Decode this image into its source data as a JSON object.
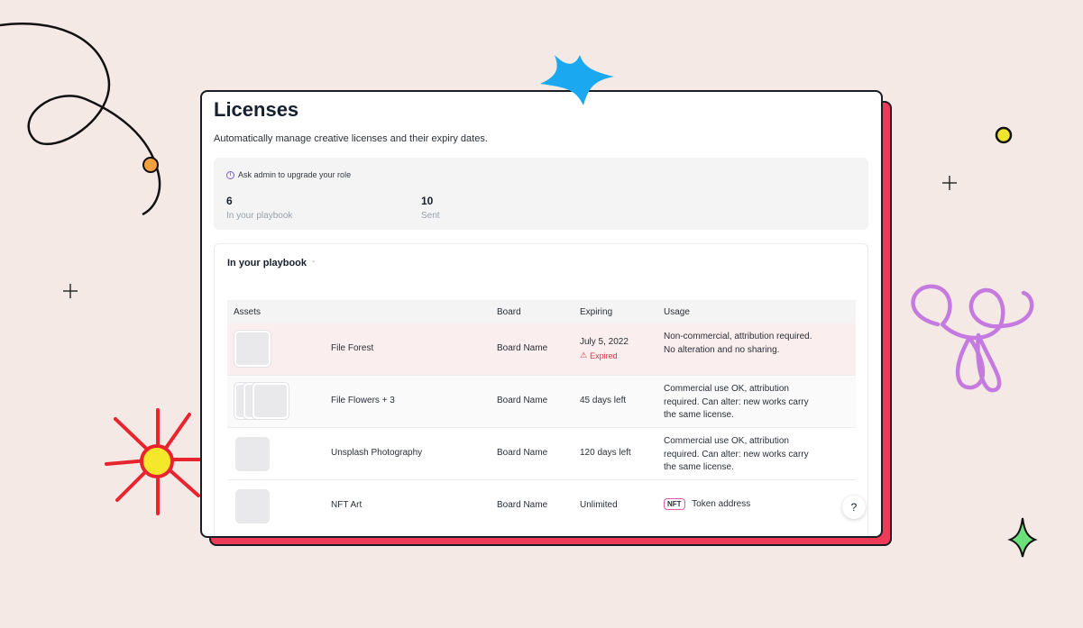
{
  "page": {
    "title": "Licenses",
    "subtitle": "Automatically manage creative licenses and their expiry dates."
  },
  "stats": {
    "note": "Ask admin to upgrade your role",
    "items": [
      {
        "value": "6",
        "label": "In your playbook"
      },
      {
        "value": "10",
        "label": "Sent"
      }
    ]
  },
  "section": {
    "title": "In your playbook",
    "caret": "-"
  },
  "table": {
    "headers": {
      "assets": "Assets",
      "board": "Board",
      "expiring": "Expiring",
      "usage": "Usage"
    },
    "rows": [
      {
        "name": "File Forest",
        "board": "Board Name",
        "expiring": "July 5, 2022",
        "status": "Expired",
        "usage": "Non-commercial, attribution required. No alteration and no sharing."
      },
      {
        "name": "File Flowers + 3",
        "board": "Board Name",
        "expiring": "45 days left",
        "usage": "Commercial use OK, attribution required. Can alter: new works carry the same license."
      },
      {
        "name": "Unsplash Photography",
        "board": "Board Name",
        "expiring": "120 days left",
        "usage": "Commercial use OK, attribution required. Can alter: new works carry the same license."
      },
      {
        "name": "NFT Art",
        "board": "Board Name",
        "expiring": "Unlimited",
        "badge": "NFT",
        "usage": "Token address"
      }
    ]
  },
  "help": {
    "label": "?"
  },
  "colors": {
    "accent_red": "#ef3b57",
    "expired_red": "#d6394a",
    "info_purple": "#7b5cd6",
    "decor_blue": "#1aa9f0",
    "decor_purple": "#c57ae0"
  }
}
